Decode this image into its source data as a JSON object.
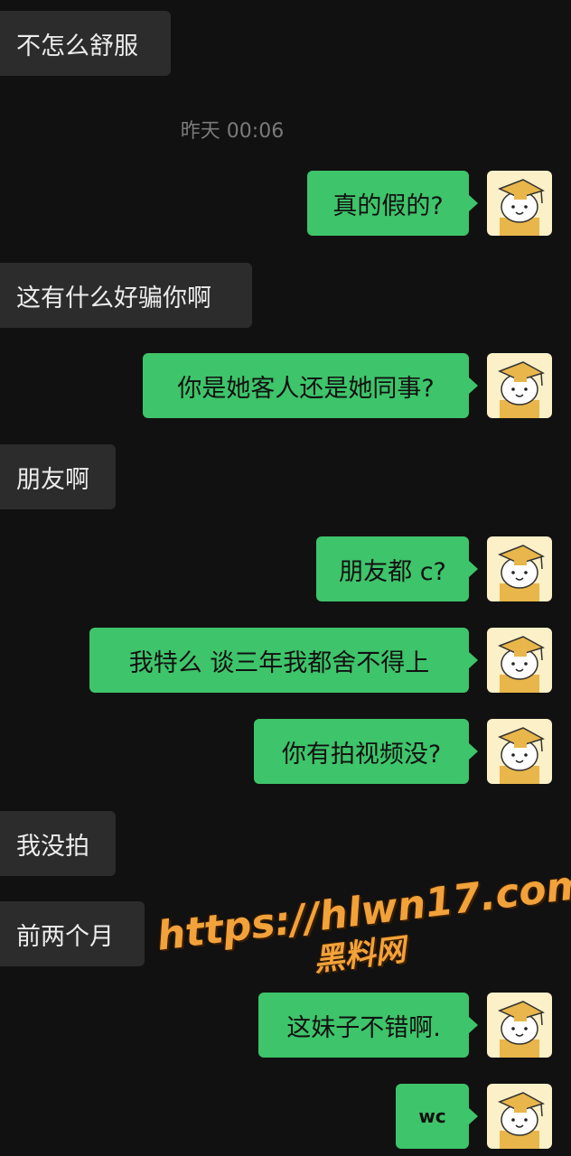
{
  "timestamp": "昨天 00:06",
  "messages": [
    {
      "side": "left",
      "text": "不怎么舒服"
    },
    {
      "side": "right",
      "text": "真的假的?"
    },
    {
      "side": "left",
      "text": "这有什么好骗你啊"
    },
    {
      "side": "right",
      "text": "你是她客人还是她同事?"
    },
    {
      "side": "left",
      "text": "朋友啊"
    },
    {
      "side": "right",
      "text": "朋友都 c?"
    },
    {
      "side": "right",
      "text": "我特么 谈三年我都舍不得上"
    },
    {
      "side": "right",
      "text": "你有拍视频没?"
    },
    {
      "side": "left",
      "text": "我没拍"
    },
    {
      "side": "left",
      "text": "前两个月"
    },
    {
      "side": "right",
      "text": "这妹子不错啊."
    },
    {
      "side": "right",
      "text": "wc"
    }
  ],
  "watermark": {
    "url": "https://hlwn17.com",
    "name": "黑料网"
  },
  "colors": {
    "background": "#111111",
    "incoming": "#2c2c2c",
    "outgoing": "#3ec46a",
    "watermark": "#f2a23a"
  },
  "icons": {
    "avatar": "cartoon-dog-graduation-cap-avatar"
  }
}
